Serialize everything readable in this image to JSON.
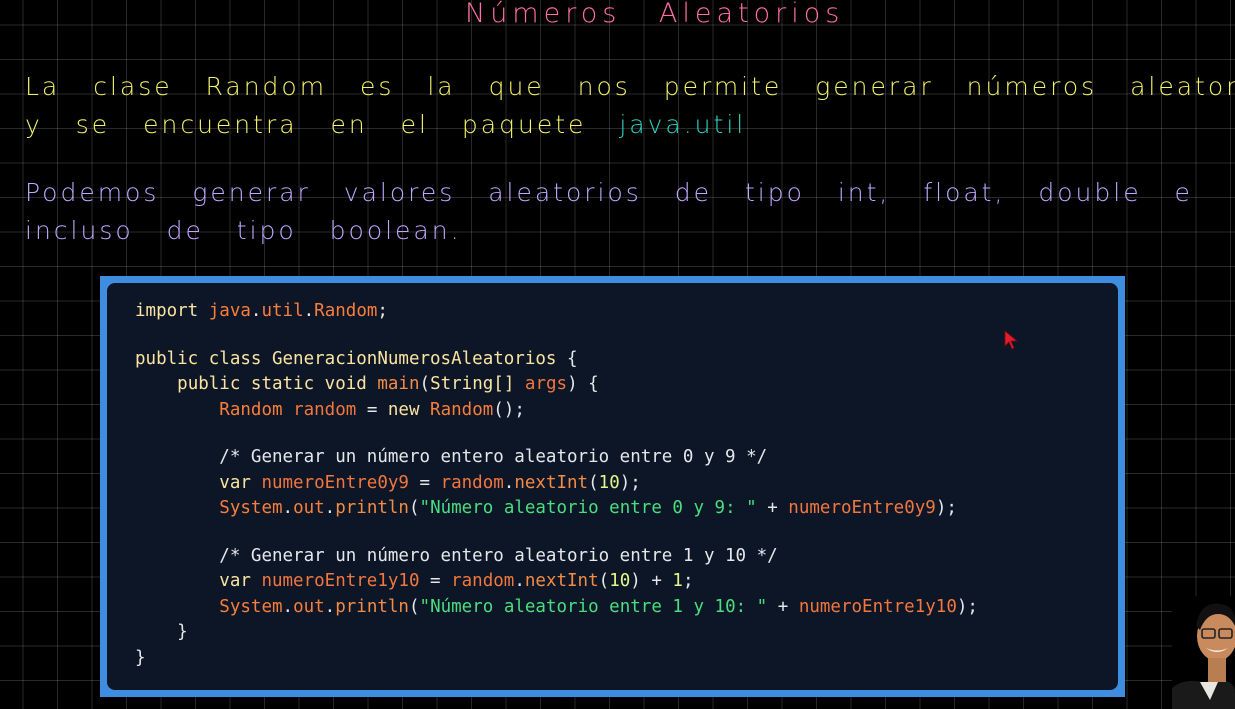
{
  "title": "Números Aleatorios",
  "paragraph1": {
    "line1": "La clase Random es la que nos permite generar números aleatorios",
    "line2_text": "y se encuentra en el paquete ",
    "line2_package": "java.util"
  },
  "paragraph2": {
    "line1": "Podemos generar valores aleatorios de tipo int, float, double e",
    "line2": "incluso de tipo boolean."
  },
  "code": {
    "l1_kw": "import",
    "l1_pkg": "java",
    "l1_dot1": ".",
    "l1_util": "util",
    "l1_dot2": ".",
    "l1_cls": "Random",
    "l1_end": ";",
    "l2_kw": "public class",
    "l2_name": "GeneracionNumerosAleatorios",
    "l2_end": " {",
    "l3_kw": "public static void",
    "l3_fn": "main",
    "l3_paren": "(",
    "l3_type": "String[]",
    "l3_arg": "args",
    "l3_end": ") {",
    "l4_cls": "Random",
    "l4_var": "random",
    "l4_eq": " = ",
    "l4_new": "new",
    "l4_cls2": "Random",
    "l4_end": "();",
    "c1": "/* Generar un número entero aleatorio entre 0 y 9 */",
    "l5_kw": "var",
    "l5_var": "numeroEntre0y9",
    "l5_eq": " = ",
    "l5_obj": "random",
    "l5_dot": ".",
    "l5_fn": "nextInt",
    "l5_p1": "(",
    "l5_num": "10",
    "l5_end": ");",
    "l6_sys": "System",
    "l6_dot1": ".",
    "l6_out": "out",
    "l6_dot2": ".",
    "l6_fn": "println",
    "l6_p1": "(",
    "l6_str": "\"Número aleatorio entre 0 y 9: \"",
    "l6_plus": " + ",
    "l6_var": "numeroEntre0y9",
    "l6_end": ");",
    "c2": "/* Generar un número entero aleatorio entre 1 y 10 */",
    "l7_kw": "var",
    "l7_var": "numeroEntre1y10",
    "l7_eq": " = ",
    "l7_obj": "random",
    "l7_dot": ".",
    "l7_fn": "nextInt",
    "l7_p1": "(",
    "l7_num": "10",
    "l7_mid": ") + ",
    "l7_num2": "1",
    "l7_end": ";",
    "l8_sys": "System",
    "l8_dot1": ".",
    "l8_out": "out",
    "l8_dot2": ".",
    "l8_fn": "println",
    "l8_p1": "(",
    "l8_str": "\"Número aleatorio entre 1 y 10: \"",
    "l8_plus": " + ",
    "l8_var": "numeroEntre1y10",
    "l8_end": ");",
    "close1": "}",
    "close2": "}"
  },
  "colors": {
    "title": "#ff6fa6",
    "yellow_text": "#f4f268",
    "package": "#2fd6c6",
    "purple_text": "#c0a6ff",
    "code_frame": "#3e8de0",
    "code_bg": "#0c1626"
  },
  "icons": [
    "mouse-cursor-icon",
    "presenter-avatar"
  ]
}
